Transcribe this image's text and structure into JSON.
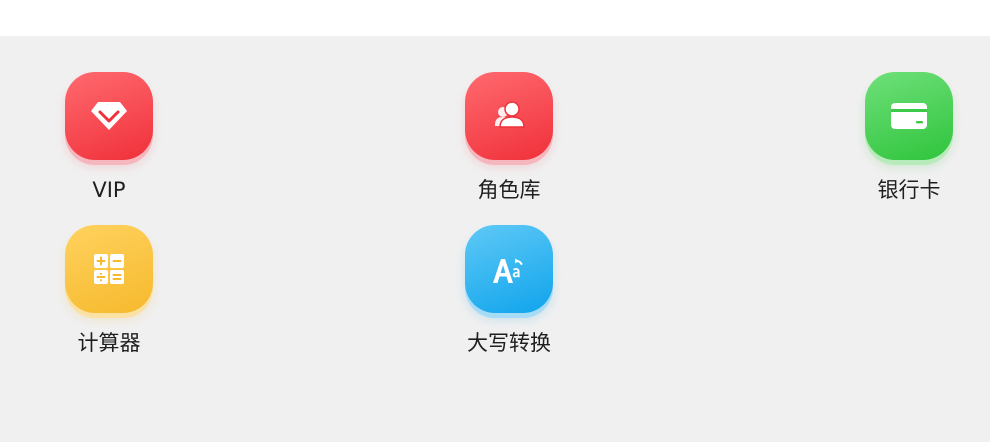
{
  "tools": [
    {
      "label": "VIP",
      "icon": "diamond-icon",
      "color": "#f0303a"
    },
    {
      "label": "角色库",
      "icon": "users-icon",
      "color": "#f0303a"
    },
    {
      "label": "银行卡",
      "icon": "bank-card-icon",
      "color": "#2fc43c"
    },
    {
      "label": "计算器",
      "icon": "calculator-icon",
      "color": "#f6b92d"
    },
    {
      "label": "大写转换",
      "icon": "text-case-icon",
      "color": "#10a4ec"
    }
  ]
}
